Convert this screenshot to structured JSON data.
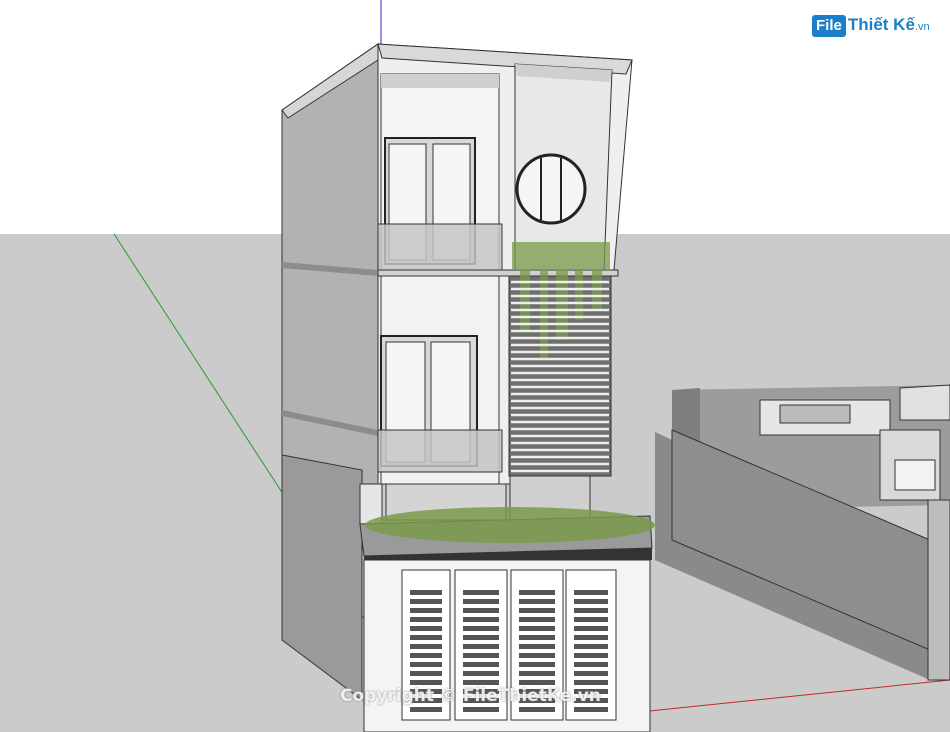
{
  "logo": {
    "box_text": "File",
    "brand_text": "Thiết Kế",
    "suffix_text": ".vn",
    "color": "#1a7fc8"
  },
  "watermark": {
    "text": "Copyright © FileThietKe.vn"
  },
  "colors": {
    "sky": "#ffffff",
    "ground": "#cbcbcb",
    "wall_light": "#f2f2f2",
    "wall_shade": "#a9a9a9",
    "wall_dark": "#8e8e8e",
    "glass": "#c8c8c8",
    "greenery": "#7a9a4a",
    "axis_green": "#2a9a2a",
    "axis_red": "#c02a2a",
    "axis_blue": "#2a2acc"
  }
}
